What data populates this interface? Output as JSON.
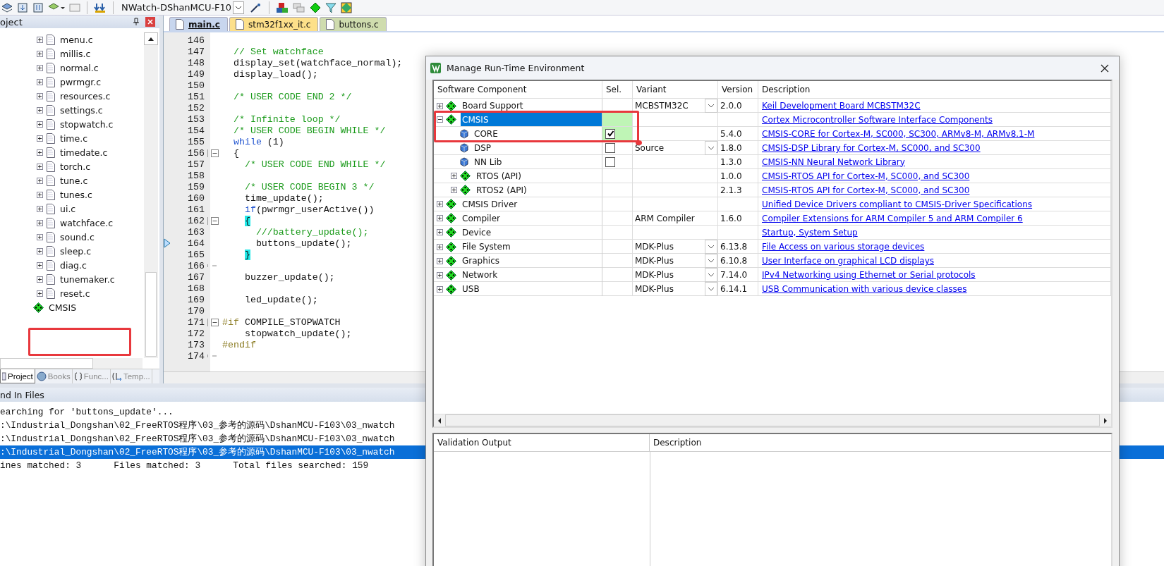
{
  "toolbar": {
    "target": "NWatch-DShanMCU-F10"
  },
  "project": {
    "title": "oject",
    "items": [
      {
        "name": "menu.c",
        "kind": "file",
        "expanded": false
      },
      {
        "name": "millis.c",
        "kind": "file",
        "expanded": false
      },
      {
        "name": "normal.c",
        "kind": "file",
        "expanded": false
      },
      {
        "name": "pwrmgr.c",
        "kind": "file",
        "expanded": false
      },
      {
        "name": "resources.c",
        "kind": "file",
        "expanded": false
      },
      {
        "name": "settings.c",
        "kind": "file",
        "expanded": false
      },
      {
        "name": "stopwatch.c",
        "kind": "file",
        "expanded": false
      },
      {
        "name": "time.c",
        "kind": "file",
        "expanded": false
      },
      {
        "name": "timedate.c",
        "kind": "file",
        "expanded": false
      },
      {
        "name": "torch.c",
        "kind": "file",
        "expanded": false
      },
      {
        "name": "tune.c",
        "kind": "file",
        "expanded": false
      },
      {
        "name": "tunes.c",
        "kind": "file",
        "expanded": false
      },
      {
        "name": "ui.c",
        "kind": "file",
        "expanded": false
      },
      {
        "name": "watchface.c",
        "kind": "file",
        "expanded": false
      },
      {
        "name": "sound.c",
        "kind": "file",
        "expanded": false
      },
      {
        "name": "sleep.c",
        "kind": "file",
        "expanded": false
      },
      {
        "name": "diag.c",
        "kind": "file",
        "expanded": false
      },
      {
        "name": "tunemaker.c",
        "kind": "file",
        "expanded": false
      },
      {
        "name": "reset.c",
        "kind": "file",
        "expanded": false
      },
      {
        "name": "CMSIS",
        "kind": "package"
      }
    ],
    "tabs": [
      {
        "label": "Project",
        "kind": "project",
        "selected": true
      },
      {
        "label": "Books",
        "kind": "books",
        "selected": false
      },
      {
        "label": "Func...",
        "kind": "functions",
        "selected": false
      },
      {
        "label": "Temp...",
        "kind": "templates",
        "selected": false
      }
    ]
  },
  "editor": {
    "tabs": [
      {
        "label": "main.c",
        "selected": true,
        "color": "#c8d6ee"
      },
      {
        "label": "stm32f1xx_it.c",
        "selected": false,
        "color": "#fde08a"
      },
      {
        "label": "buttons.c",
        "selected": false,
        "color": "#cfdcae"
      }
    ],
    "lines": [
      {
        "number": "146",
        "current": false,
        "fold_start": false,
        "fold_end": false
      },
      {
        "number": "147",
        "current": false,
        "fold_start": false,
        "fold_end": false,
        "parts": [
          {
            "text": "  // Set watchface",
            "kind": "comment"
          }
        ]
      },
      {
        "number": "148",
        "current": false,
        "fold_start": false,
        "fold_end": false,
        "parts": [
          {
            "text": "  display_set(watchface_normal);",
            "kind": "plain"
          }
        ]
      },
      {
        "number": "149",
        "current": false,
        "fold_start": false,
        "fold_end": false,
        "parts": [
          {
            "text": "  display_load();",
            "kind": "plain"
          }
        ]
      },
      {
        "number": "150",
        "current": false,
        "fold_start": false,
        "fold_end": false
      },
      {
        "number": "151",
        "current": false,
        "fold_start": false,
        "fold_end": false,
        "parts": [
          {
            "text": "  /* USER CODE END 2 */",
            "kind": "comment"
          }
        ]
      },
      {
        "number": "152",
        "current": false,
        "fold_start": false,
        "fold_end": false
      },
      {
        "number": "153",
        "current": false,
        "fold_start": false,
        "fold_end": false,
        "parts": [
          {
            "text": "  /* Infinite loop */",
            "kind": "comment"
          }
        ]
      },
      {
        "number": "154",
        "current": false,
        "fold_start": false,
        "fold_end": false,
        "parts": [
          {
            "text": "  /* USER CODE BEGIN WHILE */",
            "kind": "comment"
          }
        ]
      },
      {
        "number": "155",
        "current": false,
        "fold_start": false,
        "fold_end": false,
        "parts": [
          {
            "text": "  while",
            "kind": "keyword"
          },
          {
            "text": " (1)",
            "kind": "plain"
          }
        ]
      },
      {
        "number": "156",
        "current": false,
        "fold_start": true,
        "fold_end": false,
        "parts": [
          {
            "text": "  {",
            "kind": "plain"
          }
        ]
      },
      {
        "number": "157",
        "current": false,
        "fold_start": false,
        "fold_end": false,
        "parts": [
          {
            "text": "    /* USER CODE END WHILE */",
            "kind": "comment"
          }
        ]
      },
      {
        "number": "158",
        "current": false,
        "fold_start": false,
        "fold_end": false
      },
      {
        "number": "159",
        "current": false,
        "fold_start": false,
        "fold_end": false,
        "parts": [
          {
            "text": "    /* USER CODE BEGIN 3 */",
            "kind": "comment"
          }
        ]
      },
      {
        "number": "160",
        "current": false,
        "fold_start": false,
        "fold_end": false,
        "parts": [
          {
            "text": "    time_update();",
            "kind": "plain"
          }
        ]
      },
      {
        "number": "161",
        "current": false,
        "fold_start": false,
        "fold_end": false,
        "parts": [
          {
            "text": "    if",
            "kind": "keyword"
          },
          {
            "text": "(pwrmgr_userActive())",
            "kind": "plain"
          }
        ]
      },
      {
        "number": "162",
        "current": false,
        "fold_start": true,
        "fold_end": false,
        "parts": [
          {
            "text": "    {",
            "kind": "match"
          }
        ]
      },
      {
        "number": "163",
        "current": false,
        "fold_start": false,
        "fold_end": false,
        "parts": [
          {
            "text": "      ///battery_update();",
            "kind": "comment"
          }
        ]
      },
      {
        "number": "164",
        "current": true,
        "fold_start": false,
        "fold_end": false,
        "parts": [
          {
            "text": "      buttons_update();",
            "kind": "plain"
          }
        ]
      },
      {
        "number": "165",
        "current": false,
        "fold_start": false,
        "fold_end": false,
        "parts": [
          {
            "text": "    }",
            "kind": "match"
          }
        ]
      },
      {
        "number": "166",
        "current": false,
        "fold_start": false,
        "fold_end": true
      },
      {
        "number": "167",
        "current": false,
        "fold_start": false,
        "fold_end": false,
        "parts": [
          {
            "text": "    buzzer_update();",
            "kind": "plain"
          }
        ]
      },
      {
        "number": "168",
        "current": false,
        "fold_start": false,
        "fold_end": false
      },
      {
        "number": "169",
        "current": false,
        "fold_start": false,
        "fold_end": false,
        "parts": [
          {
            "text": "    led_update();",
            "kind": "plain"
          }
        ]
      },
      {
        "number": "170",
        "current": false,
        "fold_start": false,
        "fold_end": false
      },
      {
        "number": "171",
        "current": false,
        "fold_start": true,
        "fold_end": false,
        "parts": [
          {
            "text": "#if",
            "kind": "preproc"
          },
          {
            "text": " COMPILE_STOPWATCH",
            "kind": "plain"
          }
        ]
      },
      {
        "number": "172",
        "current": false,
        "fold_start": false,
        "fold_end": false,
        "parts": [
          {
            "text": "    stopwatch_update();",
            "kind": "plain"
          }
        ]
      },
      {
        "number": "173",
        "current": false,
        "fold_start": false,
        "fold_end": false,
        "parts": [
          {
            "text": "#endif",
            "kind": "preproc"
          }
        ]
      },
      {
        "number": "174",
        "current": false,
        "fold_start": false,
        "fold_end": true
      }
    ]
  },
  "find": {
    "title": "nd In Files",
    "lines": [
      {
        "text": "earching for 'buttons_update'...",
        "selected": false
      },
      {
        "text": ":\\Industrial_Dongshan\\02_FreeRTOS程序\\03_参考的源码\\DshanMCU-F103\\03_nwatch",
        "selected": false
      },
      {
        "text": ":\\Industrial_Dongshan\\02_FreeRTOS程序\\03_参考的源码\\DshanMCU-F103\\03_nwatch",
        "selected": false
      },
      {
        "text": ":\\Industrial_Dongshan\\02_FreeRTOS程序\\03_参考的源码\\DshanMCU-F103\\03_nwatch",
        "selected": true
      },
      {
        "text": "ines matched: 3      Files matched: 3      Total files searched: 159",
        "selected": false
      }
    ]
  },
  "dialog": {
    "title": "Manage Run-Time Environment",
    "columns": [
      "Software Component",
      "Sel.",
      "Variant",
      "Version",
      "Description"
    ],
    "components": [
      {
        "name": "Board Support",
        "kind": "bundle",
        "expanded": false,
        "selected": false,
        "sel_ok": false,
        "variant": "MCBSTM32C",
        "variant_dropdown": true,
        "version": "2.0.0",
        "description": "Keil Development Board MCBSTM32C"
      },
      {
        "name": "CMSIS",
        "kind": "bundle",
        "expanded": true,
        "selected": true,
        "sel_ok": true,
        "description": "Cortex Microcontroller Software Interface Components",
        "children": [
          {
            "name": "CORE",
            "kind": "component",
            "checked": true,
            "selected": false,
            "sel_ok": true,
            "version": "5.4.0",
            "description": "CMSIS-CORE for Cortex-M, SC000, SC300, ARMv8-M, ARMv8.1-M"
          },
          {
            "name": "DSP",
            "kind": "component",
            "checked": false,
            "selected": false,
            "sel_ok": false,
            "variant": "Source",
            "variant_dropdown": true,
            "version": "1.8.0",
            "description": "CMSIS-DSP Library for Cortex-M, SC000, and SC300"
          },
          {
            "name": "NN Lib",
            "kind": "component",
            "checked": false,
            "selected": false,
            "sel_ok": false,
            "version": "1.3.0",
            "description": "CMSIS-NN Neural Network Library"
          },
          {
            "name": "RTOS (API)",
            "kind": "bundle",
            "expanded": false,
            "selected": false,
            "sel_ok": false,
            "version": "1.0.0",
            "description": "CMSIS-RTOS API for Cortex-M, SC000, and SC300"
          },
          {
            "name": "RTOS2 (API)",
            "kind": "bundle",
            "expanded": false,
            "selected": false,
            "sel_ok": false,
            "version": "2.1.3",
            "description": "CMSIS-RTOS API for Cortex-M, SC000, and SC300"
          }
        ]
      },
      {
        "name": "CMSIS Driver",
        "kind": "bundle",
        "expanded": false,
        "selected": false,
        "sel_ok": false,
        "description": "Unified Device Drivers compliant to CMSIS-Driver Specifications"
      },
      {
        "name": "Compiler",
        "kind": "bundle",
        "expanded": false,
        "selected": false,
        "sel_ok": false,
        "variant": "ARM Compiler",
        "variant_dropdown": false,
        "version": "1.6.0",
        "description": "Compiler Extensions for ARM Compiler 5 and ARM Compiler 6"
      },
      {
        "name": "Device",
        "kind": "bundle",
        "expanded": false,
        "selected": false,
        "sel_ok": false,
        "description": "Startup, System Setup"
      },
      {
        "name": "File System",
        "kind": "bundle",
        "expanded": false,
        "selected": false,
        "sel_ok": false,
        "variant": "MDK-Plus",
        "variant_dropdown": true,
        "version": "6.13.8",
        "description": "File Access on various storage devices"
      },
      {
        "name": "Graphics",
        "kind": "bundle",
        "expanded": false,
        "selected": false,
        "sel_ok": false,
        "variant": "MDK-Plus",
        "variant_dropdown": true,
        "version": "6.10.8",
        "description": "User Interface on graphical LCD displays"
      },
      {
        "name": "Network",
        "kind": "bundle",
        "expanded": false,
        "selected": false,
        "sel_ok": false,
        "variant": "MDK-Plus",
        "variant_dropdown": true,
        "version": "7.14.0",
        "description": "IPv4 Networking using Ethernet or Serial protocols"
      },
      {
        "name": "USB",
        "kind": "bundle",
        "expanded": false,
        "selected": false,
        "sel_ok": false,
        "variant": "MDK-Plus",
        "variant_dropdown": true,
        "version": "6.14.1",
        "description": "USB Communication with various device classes"
      }
    ],
    "validation_columns": [
      "Validation Output",
      "Description"
    ]
  }
}
